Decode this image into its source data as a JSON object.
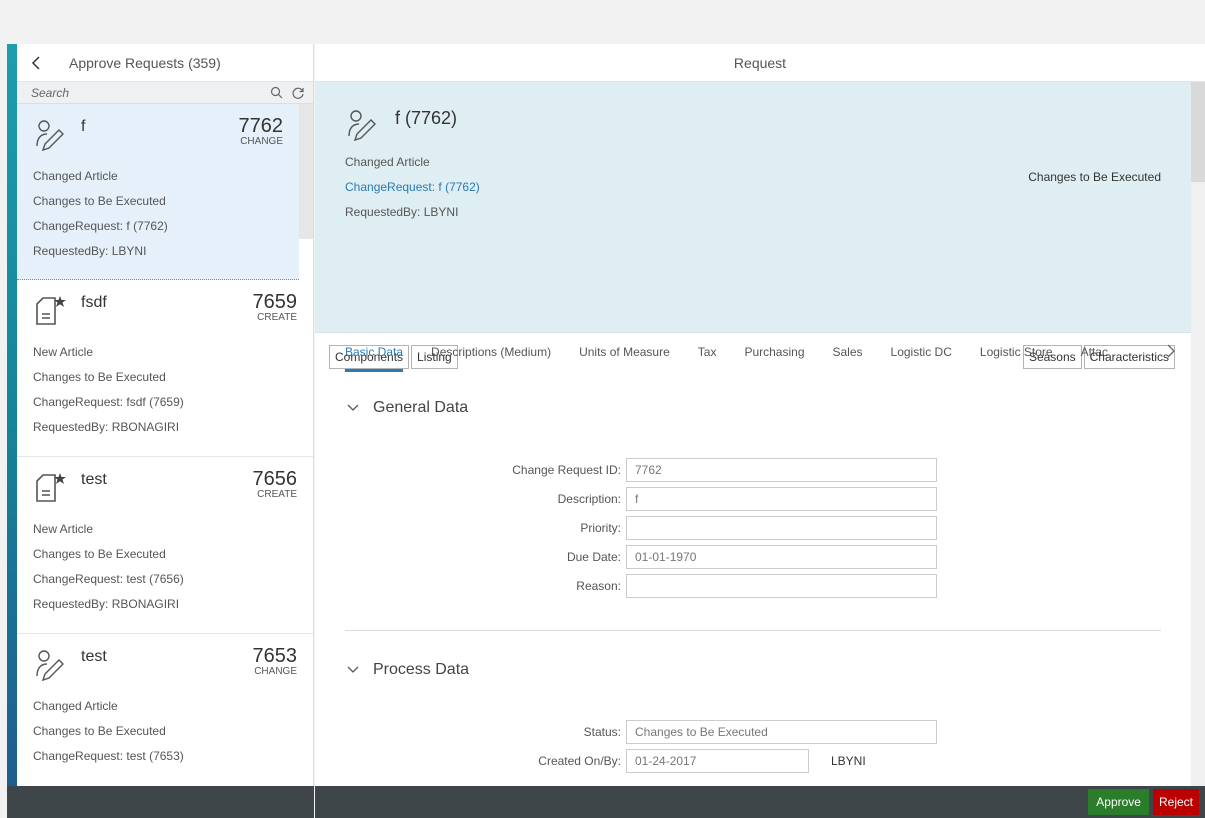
{
  "master": {
    "title": "Approve Requests (359)",
    "search_placeholder": "Search",
    "items": [
      {
        "title": "f",
        "number": "7762",
        "type": "CHANGE",
        "icon": "user-edit-icon",
        "lines": [
          "Changed Article",
          "Changes to Be Executed",
          "ChangeRequest: f (7762)",
          "RequestedBy: LBYNI"
        ]
      },
      {
        "title": "fsdf",
        "number": "7659",
        "type": "CREATE",
        "icon": "document-star-icon",
        "lines": [
          "New Article",
          "Changes to Be Executed",
          "ChangeRequest: fsdf (7659)",
          "RequestedBy: RBONAGIRI"
        ]
      },
      {
        "title": "test",
        "number": "7656",
        "type": "CREATE",
        "icon": "document-star-icon",
        "lines": [
          "New Article",
          "Changes to Be Executed",
          "ChangeRequest: test (7656)",
          "RequestedBy: RBONAGIRI"
        ]
      },
      {
        "title": "test",
        "number": "7653",
        "type": "CHANGE",
        "icon": "user-edit-icon",
        "lines": [
          "Changed Article",
          "Changes to Be Executed",
          "ChangeRequest: test (7653)"
        ]
      }
    ]
  },
  "detail": {
    "header": "Request",
    "object": {
      "title": "f (7762)",
      "attr1": "Changed Article",
      "link": "ChangeRequest: f (7762)",
      "attr3": "RequestedBy: LBYNI",
      "status": "Changes to Be Executed"
    },
    "tabs": [
      "Basic Data",
      "Descriptions (Medium)",
      "Units of Measure",
      "Tax",
      "Purchasing",
      "Sales",
      "Logistic DC",
      "Logistic Store",
      "Attac"
    ],
    "buttons_left": [
      "Components",
      "Listing"
    ],
    "buttons_right": [
      "Seasons",
      "Characteristics"
    ],
    "general": {
      "title": "General Data",
      "fields": [
        {
          "label": "Change Request ID:",
          "value": "7762"
        },
        {
          "label": "Description:",
          "value": "f"
        },
        {
          "label": "Priority:",
          "value": ""
        },
        {
          "label": "Due Date:",
          "value": "01-01-1970"
        },
        {
          "label": "Reason:",
          "value": ""
        }
      ]
    },
    "process": {
      "title": "Process Data",
      "status_label": "Status:",
      "status_value": "Changes to Be Executed",
      "created_label": "Created On/By:",
      "created_value": "01-24-2017",
      "created_by": "LBYNI"
    }
  },
  "footer": {
    "approve": "Approve",
    "reject": "Reject"
  },
  "colors": {
    "accent": "#2b79b5",
    "approve": "#2b7c2b",
    "reject": "#bb0000",
    "footer": "#3f4649"
  }
}
